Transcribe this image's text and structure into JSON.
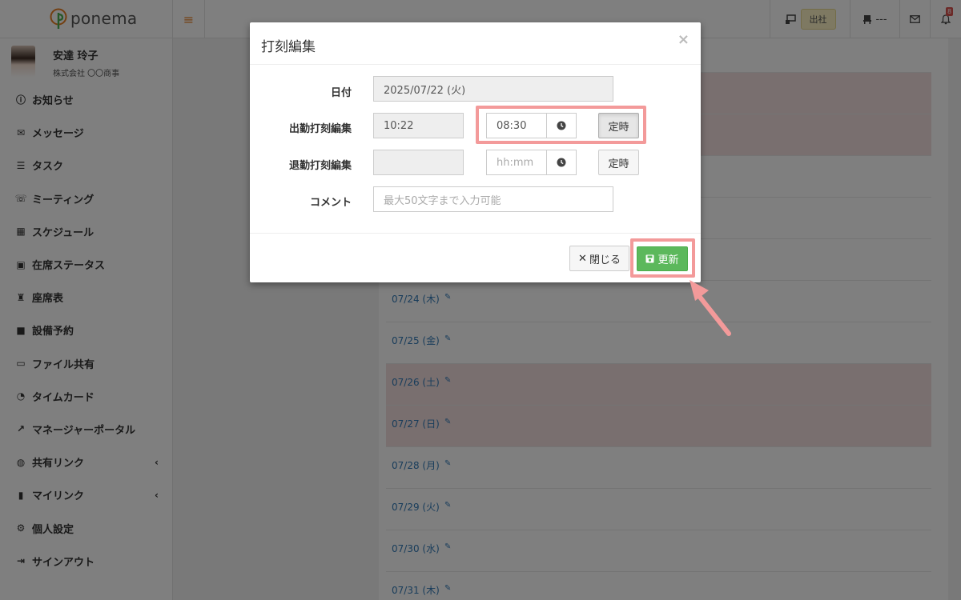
{
  "app": {
    "logo_text": "ponema"
  },
  "topbar": {
    "status_label": "出社",
    "seat_label": "---",
    "notification_count": "8"
  },
  "user": {
    "name": "安達 玲子",
    "company": "株式会社 〇〇商事"
  },
  "sidebar": {
    "items": [
      {
        "label": "お知らせ",
        "icon": "info-icon"
      },
      {
        "label": "メッセージ",
        "icon": "envelope-icon"
      },
      {
        "label": "タスク",
        "icon": "list-icon"
      },
      {
        "label": "ミーティング",
        "icon": "comments-icon"
      },
      {
        "label": "スケジュール",
        "icon": "calendar-icon"
      },
      {
        "label": "在席ステータス",
        "icon": "presence-icon"
      },
      {
        "label": "座席表",
        "icon": "chair-icon"
      },
      {
        "label": "設備予約",
        "icon": "facility-icon"
      },
      {
        "label": "ファイル共有",
        "icon": "folder-icon"
      },
      {
        "label": "タイムカード",
        "icon": "clock-icon"
      },
      {
        "label": "マネージャーポータル",
        "icon": "chart-icon"
      },
      {
        "label": "共有リンク",
        "icon": "globe-icon",
        "chevron": "‹"
      },
      {
        "label": "マイリンク",
        "icon": "bookmark-icon",
        "chevron": "‹"
      },
      {
        "label": "個人設定",
        "icon": "gear-icon"
      },
      {
        "label": "サインアウト",
        "icon": "signout-icon"
      }
    ]
  },
  "timecard_rows": [
    {
      "date": "",
      "weekend": true
    },
    {
      "date": "",
      "weekend": true
    },
    {
      "date": "",
      "weekend": false
    },
    {
      "date": "",
      "weekend": false
    },
    {
      "date": "",
      "weekend": false
    },
    {
      "date": "07/24 (木)",
      "weekend": false
    },
    {
      "date": "07/25 (金)",
      "weekend": false
    },
    {
      "date": "07/26 (土)",
      "weekend": true
    },
    {
      "date": "07/27 (日)",
      "weekend": true
    },
    {
      "date": "07/28 (月)",
      "weekend": false
    },
    {
      "date": "07/29 (火)",
      "weekend": false
    },
    {
      "date": "07/30 (水)",
      "weekend": false
    },
    {
      "date": "07/31 (木)",
      "weekend": false
    }
  ],
  "modal": {
    "title": "打刻編集",
    "close_glyph": "×",
    "date_label": "日付",
    "date_value": "2025/07/22 (火)",
    "clock_in_label": "出勤打刻編集",
    "clock_in_recorded": "10:22",
    "clock_in_value": "08:30",
    "clock_out_label": "退勤打刻編集",
    "clock_out_recorded": "",
    "clock_out_placeholder": "hh:mm",
    "fixed_time_label": "定時",
    "comment_label": "コメント",
    "comment_placeholder": "最大50文字まで入力可能",
    "close_button": "閉じる",
    "update_button": "更新"
  },
  "colors": {
    "accent_orange": "#e67e22",
    "success_green": "#5cb85c",
    "highlight_pink": "#f39a9a",
    "weekend_row": "#f2dede",
    "link_blue": "#337ab7"
  }
}
